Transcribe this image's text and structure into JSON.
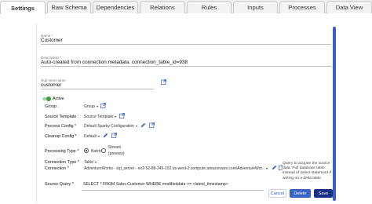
{
  "tabs": [
    "Settings",
    "Raw Schema",
    "Dependencies",
    "Relations",
    "Rules",
    "Inputs",
    "Processes",
    "Data View"
  ],
  "fields": {
    "name_label": "Name *",
    "name_value": "Customer",
    "description_label": "Description *",
    "description_value": "Auto-created from connection.metadata. connection_table_id=938",
    "hub_view_label": "Hub view name",
    "hub_view_value": "customer"
  },
  "active_label": "Active",
  "active_on": true,
  "rows": {
    "group_label": "Group :",
    "group_value": "Group",
    "source_template_label": "Source Template :",
    "source_template_value": "Source Template",
    "process_config_label": "Process Config *",
    "process_config_value": "Default Sparky Configuration",
    "cleanup_config_label": "Cleanup Config *",
    "cleanup_config_value": "Default",
    "processing_type_label": "Processing Type *",
    "processing_batch": "Batch",
    "processing_stream": "Stream",
    "processing_stream_note": "(preview)",
    "connection_type_label": "Connection Type *",
    "connection_type_value": "Table",
    "connection_label": "Connection *",
    "connection_value": "AdventureWorks - sql_server - ec2-52-88-245-102.us-west-2.compute.amazonaws.com/AdventureWor...",
    "source_query_label": "Source Query *",
    "source_query_value": "SELECT * FROM Sales.Customer WHERE modifieddate >= <latest_timestamp>"
  },
  "tooltip": "Query to acquire the source data. Pull database table instead of select statement if writing on a delta table",
  "buttons": {
    "cancel": "Cancel",
    "delete": "Delete",
    "save": "Save"
  },
  "colors": {
    "accent": "#3a63c7",
    "save": "#1a2f86",
    "toggle": "#43a047"
  },
  "icons": [
    "external-link-icon",
    "edit-pencil-icon",
    "chevron-down-icon"
  ]
}
